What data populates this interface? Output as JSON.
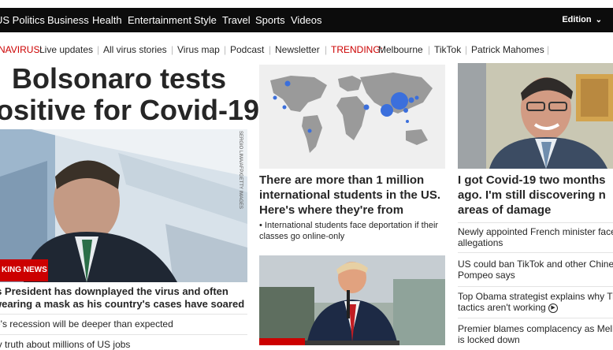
{
  "nav": {
    "items": [
      "US Politics",
      "Business",
      "Health",
      "Entertainment",
      "Style",
      "Travel",
      "Sports",
      "Videos"
    ],
    "edition": "Edition"
  },
  "subnav": {
    "coronavirus_label": "NAVIRUS:",
    "live_updates": "Live updates",
    "all_stories": "All virus stories",
    "virus_map": "Virus map",
    "podcast": "Podcast",
    "newsletter": "Newsletter",
    "trending_label": "TRENDING:",
    "trending_items": [
      "Melbourne",
      "TikTok",
      "Patrick Mahomes"
    ]
  },
  "lead": {
    "headline_line1": "Bolsonaro tests",
    "headline_line2": "ositive for Covid-19",
    "photo_credit": "SERGIO LIMA/AFP/GETTY IMAGES",
    "badge": "KING NEWS",
    "caption": "'s President has downplayed the virus and often wearing a mask as his country's cases have soared",
    "links": [
      "e's recession will be deeper than expected",
      "ly truth about millions of US jobs"
    ]
  },
  "middle": {
    "headline": "There are more than 1 million international students in the US. Here's where they're from",
    "sub": "• International students face deportation if their classes go online-only"
  },
  "right": {
    "headline_line1": "I got Covid-19 two months",
    "headline_line2": "ago. I'm still discovering n",
    "headline_line3": "areas of damage",
    "links": [
      {
        "line1": "Newly appointed French minister face",
        "line2": "allegations"
      },
      {
        "line1": "US could ban TikTok and other Chines",
        "line2": "Pompeo says"
      },
      {
        "line1": "Top Obama strategist explains why Tru",
        "line2": "tactics aren't working"
      },
      {
        "line1": "Premier blames complacency as Melb",
        "line2": "is locked down"
      }
    ]
  },
  "colors": {
    "nav_bg": "#0c0c0c",
    "accent_red": "#cc0000",
    "map_dot": "#3b6fdc"
  }
}
